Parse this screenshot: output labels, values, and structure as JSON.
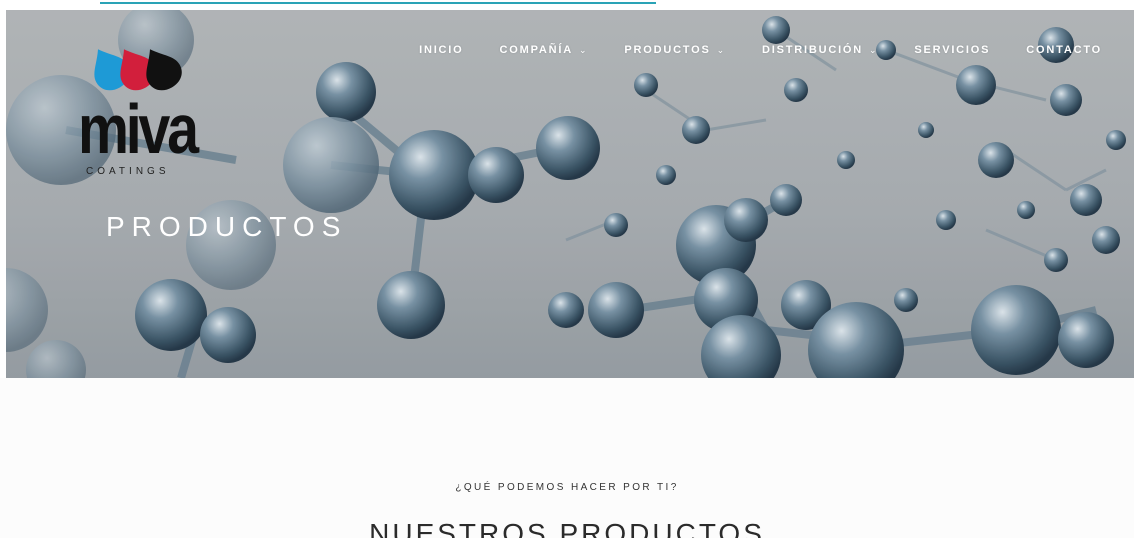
{
  "brand": {
    "name": "miva",
    "sub": "COATINGS",
    "drop_colors": [
      "#1e9ad6",
      "#d21f3c",
      "#111111"
    ]
  },
  "nav": {
    "items": [
      {
        "label": "INICIO",
        "dropdown": false
      },
      {
        "label": "COMPAÑÍA",
        "dropdown": true
      },
      {
        "label": "PRODUCTOS",
        "dropdown": true
      },
      {
        "label": "DISTRIBUCIÓN",
        "dropdown": true
      },
      {
        "label": "SERVICIOS",
        "dropdown": false
      },
      {
        "label": "CONTACTO",
        "dropdown": false
      }
    ]
  },
  "hero": {
    "title": "PRODUCTOS"
  },
  "section": {
    "eyebrow": "¿QUÉ PODEMOS HACER POR TI?",
    "title": "NUESTROS PRODUCTOS"
  },
  "colors": {
    "link_underline": "#2aa3b6",
    "molecule": "#4f6b80"
  }
}
